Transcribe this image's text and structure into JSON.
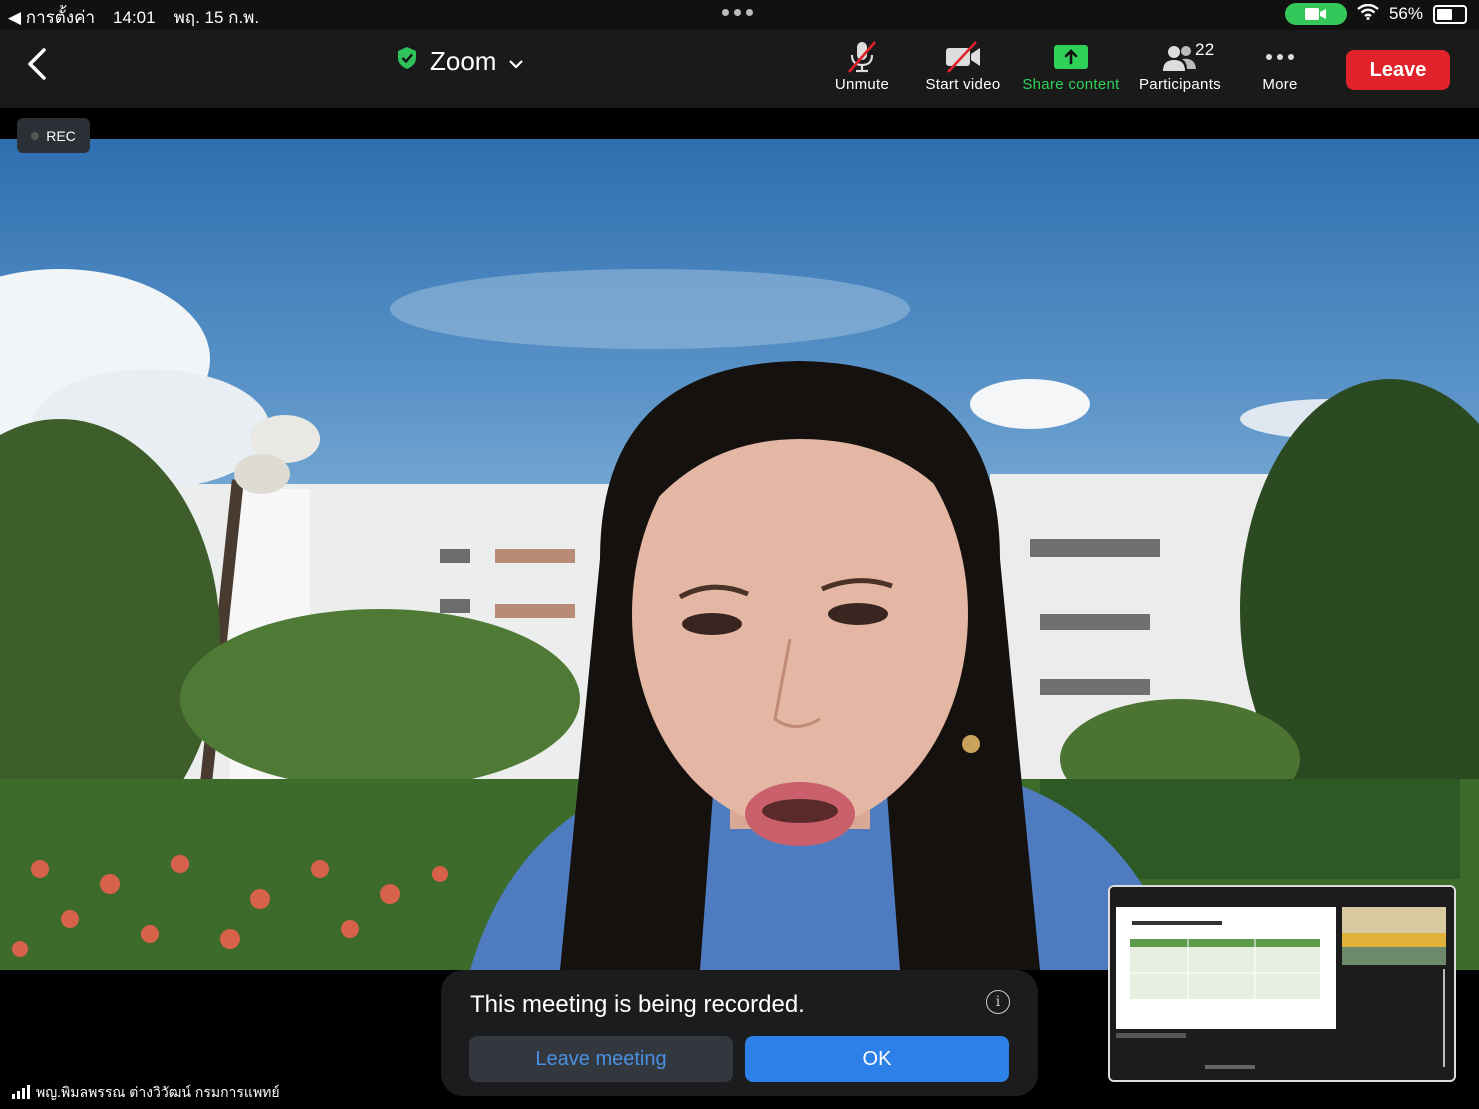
{
  "status_bar": {
    "back_app": "◀ การตั้งค่า",
    "time": "14:01",
    "date": "พฤ. 15 ก.พ.",
    "battery_percent": "56%",
    "battery_level": 0.56
  },
  "toolbar": {
    "title": "Zoom",
    "unmute_label": "Unmute",
    "start_video_label": "Start video",
    "share_label": "Share content",
    "participants_label": "Participants",
    "participants_count": "22",
    "more_label": "More",
    "leave_label": "Leave"
  },
  "rec_badge": "REC",
  "notice": {
    "message": "This meeting is being recorded.",
    "leave_meeting_label": "Leave meeting",
    "ok_label": "OK"
  },
  "speaker_name": "พญ.พิมลพรรณ ต่างวิวัฒน์ กรมการแพทย์",
  "colors": {
    "leave_red": "#e1222a",
    "share_green": "#2fd158",
    "ok_blue": "#2d80e8"
  }
}
